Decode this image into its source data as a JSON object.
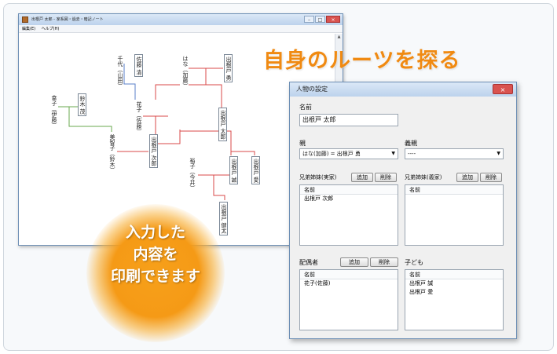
{
  "app": {
    "title": "出根戸 太郎 - 家系図・過去・暗記ノート",
    "menu": [
      "編集(E)",
      "ヘルプ(H)"
    ],
    "controls": [
      "–",
      "□",
      "×"
    ]
  },
  "tree": {
    "people": [
      {
        "id": "chiyo",
        "name": "千代（山田）"
      },
      {
        "id": "sato_kiyoshi",
        "name": "佐藤 清"
      },
      {
        "id": "hana",
        "name": "はな（加藤）"
      },
      {
        "id": "isamu",
        "name": "出根戸 勇"
      },
      {
        "id": "hanako",
        "name": "花子（佐藤）"
      },
      {
        "id": "taro",
        "name": "出根戸 太郎"
      },
      {
        "id": "sachiko",
        "name": "幸子（伊藤）"
      },
      {
        "id": "suzuki_shige",
        "name": "鈴木 茂"
      },
      {
        "id": "michiko",
        "name": "美智子（鈴木）"
      },
      {
        "id": "jiro",
        "name": "出根戸 次郎"
      },
      {
        "id": "yuko",
        "name": "裕子（今井）"
      },
      {
        "id": "makoto",
        "name": "出根戸 誠"
      },
      {
        "id": "ai",
        "name": "出根戸 愛"
      },
      {
        "id": "kenta",
        "name": "出根戸 健太"
      }
    ],
    "colors": {
      "red": "#d94a4a",
      "blue": "#5a7fc8",
      "green": "#6aa84f"
    }
  },
  "headline": "自身のルーツを探る",
  "badge": {
    "lines": [
      "入力した",
      "内容を",
      "印刷できます"
    ],
    "color": "#f59a16"
  },
  "dialog": {
    "title": "人物の設定",
    "close": "×",
    "name_label": "名前",
    "name_value": "出根戸 太郎",
    "parent_label": "親",
    "parent_value": "はな(加藤) = 出根戸 勇",
    "adoptive_label": "義親",
    "adoptive_value": "----",
    "siblings_real_label": "兄弟姉妹(実家)",
    "siblings_adopt_label": "兄弟姉妹(義家)",
    "spouse_label": "配偶者",
    "children_label": "子ども",
    "add": "追加",
    "remove": "削除",
    "col_name": "名前",
    "siblings_real": [
      "出根戸 次郎"
    ],
    "spouses": [
      "花子(佐藤)"
    ],
    "children": [
      "出根戸 誠",
      "出根戸 愛"
    ]
  }
}
